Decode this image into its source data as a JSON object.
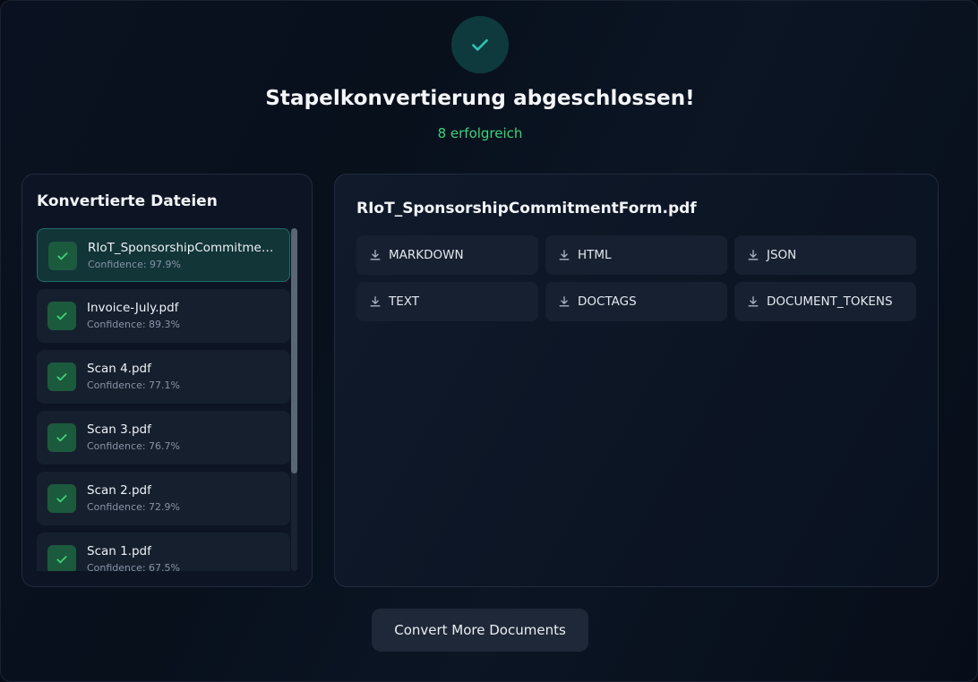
{
  "header": {
    "title": "Stapelkonvertierung abgeschlossen!",
    "subtitle": "8 erfolgreich",
    "success_icon": "check-icon"
  },
  "files_panel": {
    "heading": "Konvertierte Dateien",
    "items": [
      {
        "name": "RIoT_SponsorshipCommitmentForm.pdf",
        "confidence": "Confidence: 97.9%",
        "active": true
      },
      {
        "name": "Invoice-July.pdf",
        "confidence": "Confidence: 89.3%",
        "active": false
      },
      {
        "name": "Scan 4.pdf",
        "confidence": "Confidence: 77.1%",
        "active": false
      },
      {
        "name": "Scan 3.pdf",
        "confidence": "Confidence: 76.7%",
        "active": false
      },
      {
        "name": "Scan 2.pdf",
        "confidence": "Confidence: 72.9%",
        "active": false
      },
      {
        "name": "Scan 1.pdf",
        "confidence": "Confidence: 67.5%",
        "active": false
      }
    ]
  },
  "detail_panel": {
    "title": "RIoT_SponsorshipCommitmentForm.pdf",
    "formats": [
      {
        "label": "MARKDOWN",
        "icon": "download-icon"
      },
      {
        "label": "HTML",
        "icon": "download-icon"
      },
      {
        "label": "JSON",
        "icon": "download-icon"
      },
      {
        "label": "TEXT",
        "icon": "download-icon"
      },
      {
        "label": "DOCTAGS",
        "icon": "download-icon"
      },
      {
        "label": "DOCUMENT_TOKENS",
        "icon": "download-icon"
      }
    ]
  },
  "footer": {
    "convert_more_label": "Convert More Documents"
  },
  "colors": {
    "success_green": "#3fd37a",
    "accent_teal": "#2fc3b0",
    "background": "#060b16"
  }
}
